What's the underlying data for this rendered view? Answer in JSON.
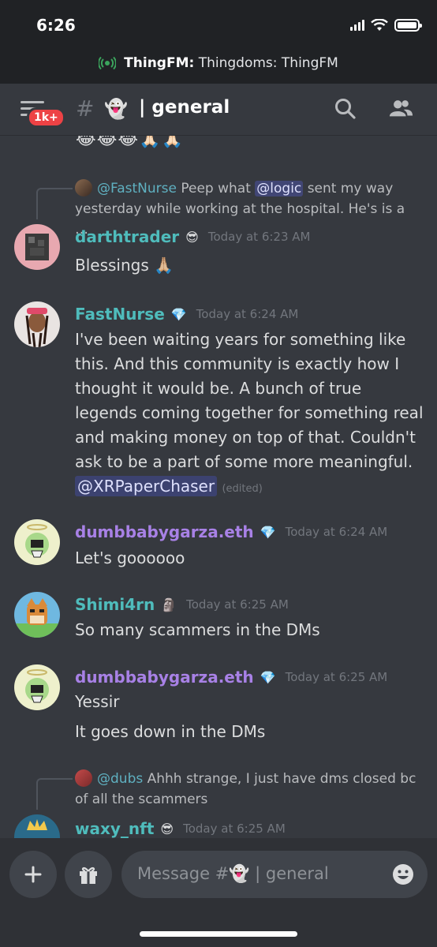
{
  "status": {
    "time": "6:26"
  },
  "now_playing": {
    "server": "ThingFM:",
    "track": "Thingdoms: ThingFM",
    "icon": "broadcast-icon"
  },
  "header": {
    "badge": "1k+",
    "hash": "#",
    "channel_emoji": "👻",
    "separator": "|",
    "channel": "general"
  },
  "top_emojis": "😂😂😂🙏🏻🙏🏻",
  "messages": [
    {
      "reply": {
        "user": "@FastNurse",
        "text_before": " Peep what ",
        "mention": "@logic",
        "text_after": " sent my way",
        "line2": "yesterday while working at the hospital. He's is a …"
      },
      "user": "darthtrader",
      "color": "#4fbcbc",
      "badge": "😎",
      "time": "Today at 6:23 AM",
      "lines": [
        "Blessings 🙏🏼"
      ]
    },
    {
      "user": "FastNurse",
      "color": "#4fbcbc",
      "badge": "💎",
      "time": "Today at 6:24 AM",
      "lines": [
        "I've been waiting years for something like this. And this community is exactly how I thought it would be. A bunch of true legends coming together for something real and making money on top of that. Couldn't ask to be a part of some more meaningful."
      ],
      "mention": "@XRPaperChaser",
      "edited": "(edited)"
    },
    {
      "user": "dumbbabygarza.eth",
      "color": "#a881e6",
      "badge": "💎",
      "time": "Today at 6:24 AM",
      "lines": [
        "Let's goooooo"
      ]
    },
    {
      "user": "Shimi4rn",
      "color": "#4fbcbc",
      "badge": "🗿",
      "time": "Today at 6:25 AM",
      "lines": [
        "So many scammers in the DMs"
      ]
    },
    {
      "user": "dumbbabygarza.eth",
      "color": "#a881e6",
      "badge": "💎",
      "time": "Today at 6:25 AM",
      "lines": [
        "Yessir",
        "It goes down in the DMs"
      ]
    },
    {
      "reply": {
        "user": "@dubs",
        "text_before": " Ahhh strange, I just have dms closed bc",
        "line2": "of all the scammers"
      },
      "user": "waxy_nft",
      "color": "#4fbcbc",
      "badge": "😎",
      "time": "Today at 6:25 AM",
      "lines": []
    }
  ],
  "composer": {
    "placeholder_prefix": "Message #",
    "placeholder_emoji": "👻",
    "placeholder_sep": " | ",
    "placeholder_channel": "general"
  },
  "colors": {
    "background": "#36393f",
    "topbar": "#202225",
    "mention_bg": "#3c4270",
    "teal_name": "#4fbcbc",
    "purple_name": "#a881e6",
    "badge_red": "#ed4245"
  }
}
